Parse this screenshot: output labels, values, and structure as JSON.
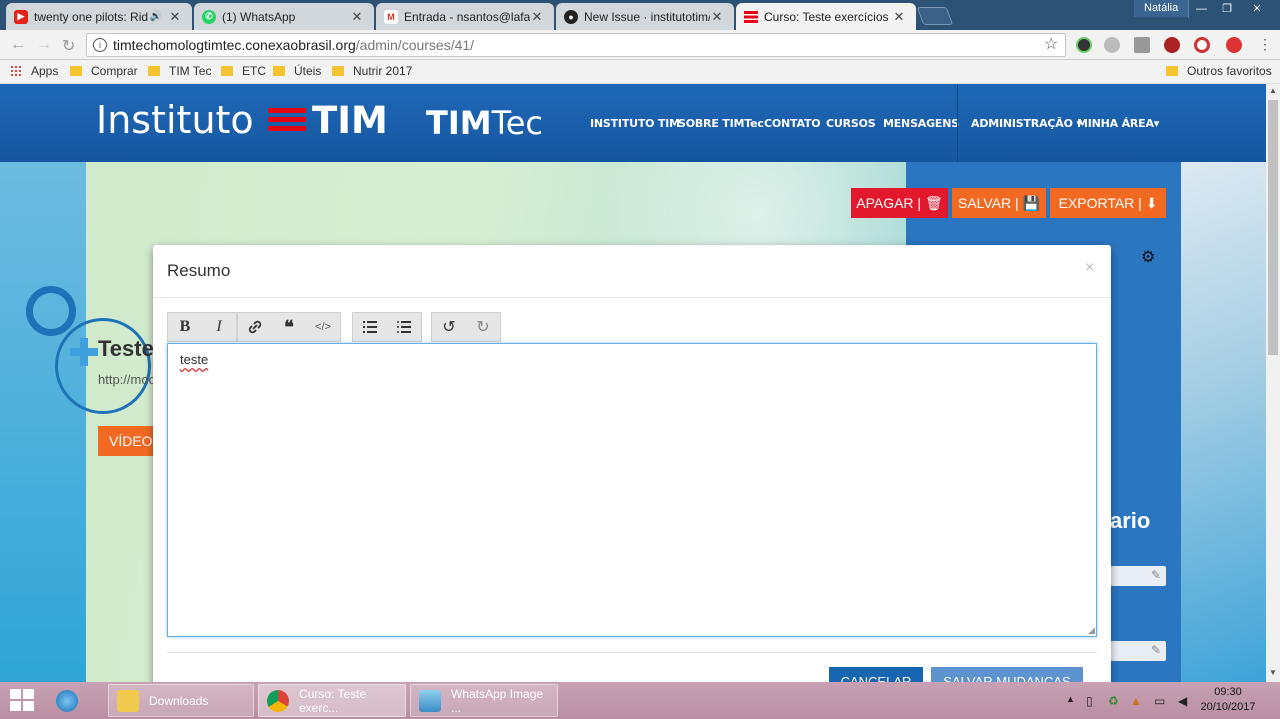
{
  "browser": {
    "tabs": [
      {
        "title": "twenty one pilots: Rid",
        "active": false,
        "favicon_color": "#e62117",
        "audio": true
      },
      {
        "title": "(1) WhatsApp",
        "active": false,
        "favicon_color": "#25d366"
      },
      {
        "title": "Entrada - nsantos@lafab",
        "active": false,
        "favicon_color": "#d93025"
      },
      {
        "title": "New Issue · institutotim/",
        "active": false,
        "favicon_color": "#222222"
      },
      {
        "title": "Curso: Teste exercícios",
        "active": true,
        "favicon_color": "#e30613"
      }
    ],
    "profile_name": "Natália",
    "url_host": "timtechomologtimtec.conexaobrasil.org",
    "url_path": "/admin/courses/41/",
    "bookmarks": [
      "Apps",
      "Comprar",
      "TIM Tec",
      "ETC",
      "Úteis",
      "Nutrir 2017"
    ],
    "other_bookmarks": "Outros favoritos"
  },
  "site": {
    "logo_instituto": "Instituto",
    "logo_tim": "TIM",
    "logo_timtec_bold": "TIM",
    "logo_timtec_light": "Tec",
    "nav": [
      {
        "label": "INSTITUTO TIM"
      },
      {
        "label_pre": "SOBRE ",
        "label_bold": "TIM",
        "label_post": "Tec"
      },
      {
        "label": "CONTATO"
      },
      {
        "label": "CURSOS"
      },
      {
        "label": "MENSAGENS"
      },
      {
        "label": "ADMINISTRAÇÃO ▾"
      },
      {
        "label": "MINHA ÁREA▾"
      }
    ],
    "actions": {
      "delete": "APAGAR | 🗑",
      "save": "SALVAR | 💾",
      "export": "EXPORTAR | ⬇"
    },
    "colors": {
      "header": "#1f68b6",
      "delete": "#e3182d",
      "save": "#f26a21",
      "export": "#f26a21",
      "video_tab": "#f26a21"
    },
    "background": {
      "course_title": "Teste",
      "course_url": "http://moo",
      "video_tab": "VÍDEO",
      "right_heading": "ario"
    }
  },
  "modal": {
    "title": "Resumo",
    "close": "×",
    "toolbar": {
      "bold": "B",
      "italic": "I",
      "link_icon": "link-icon",
      "quote_icon": "quote-icon",
      "code_icon": "code-icon",
      "ordered_list_icon": "ordered-list-icon",
      "unordered_list_icon": "unordered-list-icon",
      "undo_icon": "undo-icon",
      "redo_icon": "redo-icon"
    },
    "content": "teste",
    "cancel_label": "CANCELAR",
    "save_label": "SALVAR MUDANÇAS"
  },
  "taskbar": {
    "items": [
      "Downloads",
      "Curso: Teste exerc...",
      "WhatsApp Image ..."
    ],
    "time": "09:30",
    "date": "20/10/2017"
  }
}
